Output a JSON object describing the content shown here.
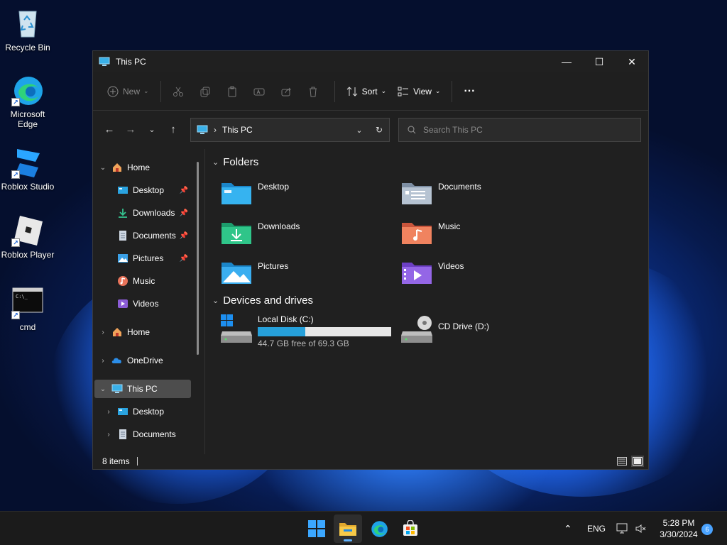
{
  "desktop": {
    "icons": [
      {
        "label": "Recycle Bin",
        "icon": "recycle-bin-icon"
      },
      {
        "label": "Microsoft Edge",
        "icon": "edge-icon"
      },
      {
        "label": "Roblox Studio",
        "icon": "roblox-studio-icon"
      },
      {
        "label": "Roblox Player",
        "icon": "roblox-player-icon"
      },
      {
        "label": "cmd",
        "icon": "cmd-icon"
      }
    ]
  },
  "window": {
    "title": "This PC",
    "controls": {
      "minimize": "—",
      "maximize": "☐",
      "close": "✕"
    },
    "toolbar": {
      "new_label": "New",
      "sort_label": "Sort",
      "view_label": "View",
      "more_label": "···"
    },
    "address": {
      "path": "This PC"
    },
    "search": {
      "placeholder": "Search This PC"
    }
  },
  "sidebar": {
    "items": [
      {
        "label": "Home",
        "pinned": false
      },
      {
        "label": "Desktop",
        "pinned": true
      },
      {
        "label": "Downloads",
        "pinned": true
      },
      {
        "label": "Documents",
        "pinned": true
      },
      {
        "label": "Pictures",
        "pinned": true
      },
      {
        "label": "Music",
        "pinned": false
      },
      {
        "label": "Videos",
        "pinned": false
      },
      {
        "label": "Home",
        "pinned": false
      },
      {
        "label": "OneDrive",
        "pinned": false
      },
      {
        "label": "This PC",
        "pinned": false,
        "selected": true
      },
      {
        "label": "Desktop",
        "pinned": false
      },
      {
        "label": "Documents",
        "pinned": false
      }
    ]
  },
  "content": {
    "folders_heading": "Folders",
    "folders": [
      {
        "label": "Desktop"
      },
      {
        "label": "Documents"
      },
      {
        "label": "Downloads"
      },
      {
        "label": "Music"
      },
      {
        "label": "Pictures"
      },
      {
        "label": "Videos"
      }
    ],
    "devices_heading": "Devices and drives",
    "drives": [
      {
        "label": "Local Disk (C:)",
        "free_text": "44.7 GB free of 69.3 GB",
        "used_fraction": 0.355
      },
      {
        "label": "CD Drive (D:)"
      }
    ]
  },
  "status": {
    "items": "8 items"
  },
  "taskbar": {
    "lang": "ENG",
    "time": "5:28 PM",
    "date": "3/30/2024",
    "notifications": "6"
  },
  "colors": {
    "accent": "#26a0da",
    "selected": "#4d4d4d"
  }
}
